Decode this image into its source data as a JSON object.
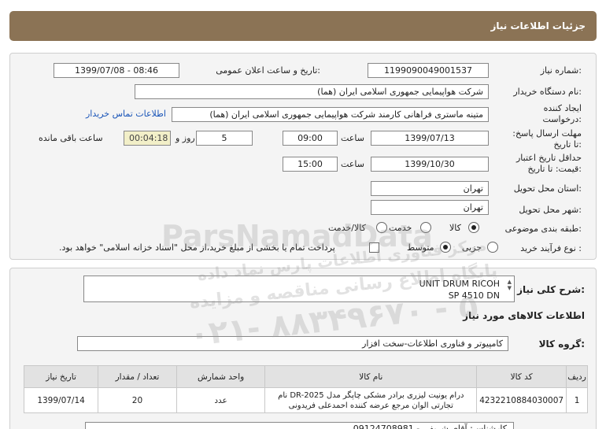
{
  "header": {
    "title": "جزئیات اطلاعات نیاز"
  },
  "fields": {
    "need_number_label": "شماره نیاز:",
    "need_number": "1199090049001537",
    "announce_label": "تاریخ و ساعت اعلان عمومی:",
    "announce_value": "1399/07/08 - 08:46",
    "buyer_label": "نام دستگاه خریدار:",
    "buyer_value": "شرکت هواپیمایی جمهوری اسلامی ایران (هما)",
    "creator_label": "ایجاد کننده درخواست:",
    "creator_value": "متینه ماستری فراهانی کارمند شرکت هواپیمایی جمهوری اسلامی ایران (هما)",
    "contact_link": "اطلاعات تماس خریدار",
    "deadline_label": "مهلت ارسال پاسخ: تا تاریخ:",
    "deadline_date": "1399/07/13",
    "time_label": "ساعت",
    "deadline_time": "09:00",
    "days_value": "5",
    "days_label": "روز و",
    "remaining_value": "00:04:18",
    "remaining_label": "ساعت باقی مانده",
    "validity_label": "حداقل تاریخ اعتبار قیمت: تا تاریخ:",
    "validity_date": "1399/10/30",
    "validity_time_label": "ساعت",
    "validity_time": "15:00",
    "province_label": "استان محل تحویل:",
    "province_value": "تهران",
    "city_label": "شهر محل تحویل:",
    "city_value": "تهران",
    "category_label": "طبقه بندی موضوعی:",
    "category_options": [
      "کالا",
      "خدمت",
      "کالا/خدمت"
    ],
    "category_selected": "کالا",
    "process_label": "نوع فرآیند خرید :",
    "process_options": [
      "جزیی",
      "متوسط"
    ],
    "process_selected": "متوسط",
    "process_note": "پرداخت تمام یا بخشی از مبلغ خرید،از محل \"اسناد خزانه اسلامی\" خواهد بود."
  },
  "detail": {
    "general_desc_label": "شرح کلی نیاز:",
    "general_desc_line1": "UNIT DRUM RICOH",
    "general_desc_line2": "SP 4510 DN",
    "goods_info_title": "اطلاعات کالاهای مورد نیاز",
    "group_label": "گروه کالا:",
    "group_value": "کامپیوتر و فناوری اطلاعات-سخت افزار",
    "table": {
      "headers": [
        "ردیف",
        "کد کالا",
        "نام کالا",
        "واحد شمارش",
        "تعداد / مقدار",
        "تاریخ نیاز"
      ],
      "rows": [
        {
          "row": "1",
          "code": "4232210884030007",
          "name": "درام یونیت لیزری برادر مشکی چاپگر مدل DR-2025 نام تجارتی الوان مرجع عرضه کننده احمدعلی فریدونی",
          "unit": "عدد",
          "qty": "20",
          "date": "1399/07/14"
        }
      ]
    },
    "footer_text": "کارشناس: آقای شریفی - 09124708981"
  },
  "watermark": {
    "brand": "ParsNamadData",
    "line1": "مرکز فناوری اطلاعات پارس نماد داده",
    "line2": "پایگاه اطلاع رسانی مناقصه و مزایده",
    "phone": "۰۲۱- ۸۸۳۴۹۶۷۰ - ۵"
  }
}
